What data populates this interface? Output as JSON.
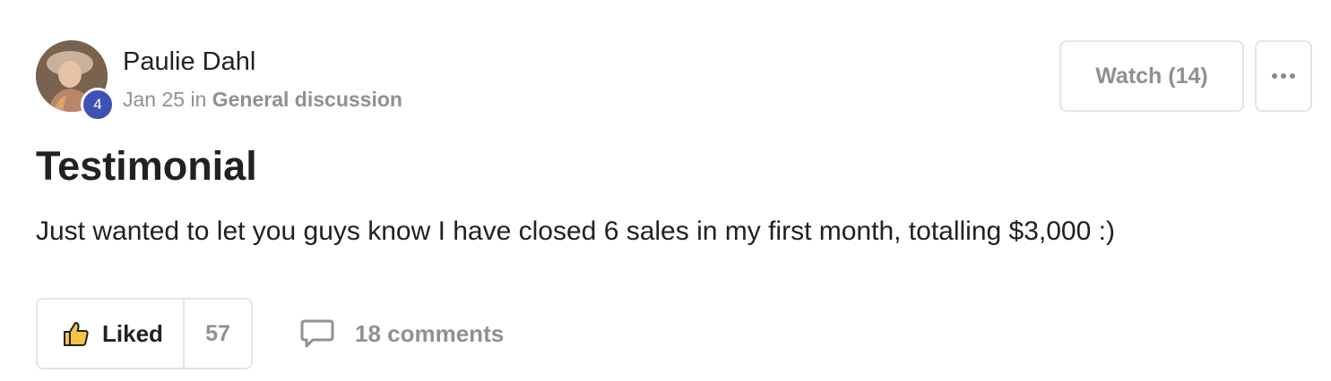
{
  "author": {
    "name": "Paulie Dahl",
    "level": "4"
  },
  "meta": {
    "date": "Jan 25",
    "in_word": "in",
    "category": "General discussion"
  },
  "actions": {
    "watch_label": "Watch (14)",
    "more_icon": "ellipsis-icon"
  },
  "post": {
    "title": "Testimonial",
    "body": "Just wanted to let you guys know I have closed 6 sales in my first month, totalling $3,000 :)"
  },
  "footer": {
    "like_label": "Liked",
    "like_icon": "thumbs-up-icon",
    "like_count": "57",
    "comments_icon": "comment-bubble-icon",
    "comments_label": "18 comments"
  },
  "colors": {
    "badge": "#3f51b5",
    "muted_text": "#909090",
    "border": "#e4e4e4",
    "thumb_fill": "#f4c542"
  }
}
